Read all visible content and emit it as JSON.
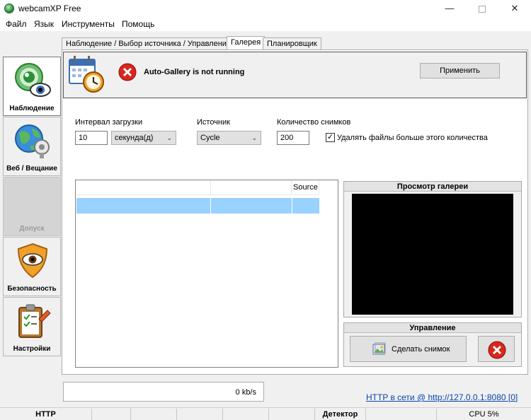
{
  "window": {
    "title": "webcamXP Free"
  },
  "menu": {
    "file": "Файл",
    "language": "Язык",
    "tools": "Инструменты",
    "help": "Помощь"
  },
  "sidebar": {
    "items": [
      {
        "label": "Наблюдение",
        "icon": "eye-lens-icon",
        "state": "active"
      },
      {
        "label": "Веб / Вещание",
        "icon": "globe-broadcast-icon",
        "state": "normal"
      },
      {
        "label": "Допуск",
        "icon": "",
        "state": "disabled"
      },
      {
        "label": "Безопасность",
        "icon": "shield-eye-icon",
        "state": "normal"
      },
      {
        "label": "Настройки",
        "icon": "clipboard-pencil-icon",
        "state": "normal"
      }
    ]
  },
  "tabs": [
    {
      "label": "Наблюдение / Выбор источника / Управление",
      "active": false
    },
    {
      "label": "Галерея",
      "active": true
    },
    {
      "label": "Планировщик",
      "active": false
    }
  ],
  "gallery": {
    "status": "Auto-Gallery is not running",
    "apply_label": "Применить",
    "interval_label": "Интервал загрузки",
    "interval_value": "10",
    "interval_unit": "секунда(д)",
    "source_label": "Источник",
    "source_value": "Cycle",
    "count_label": "Количество снимков",
    "count_value": "200",
    "delete_label": "Удалять файлы больше этого количества",
    "delete_checked": true,
    "list_columns": [
      "",
      "",
      "Source"
    ],
    "preview_title": "Просмотр галереи",
    "control_title": "Управление",
    "snapshot_label": "Сделать снимок"
  },
  "footer": {
    "rate": "0 kb/s",
    "http_link": "HTTP в сети @ http://127.0.0.1:8080 [0]"
  },
  "statusbar": {
    "http": "HTTP",
    "detector": "Детектор",
    "cpu": "CPU 5%"
  },
  "colors": {
    "selection": "#99d1ff",
    "error_red": "#d9261c",
    "preview_bg": "#000000"
  }
}
